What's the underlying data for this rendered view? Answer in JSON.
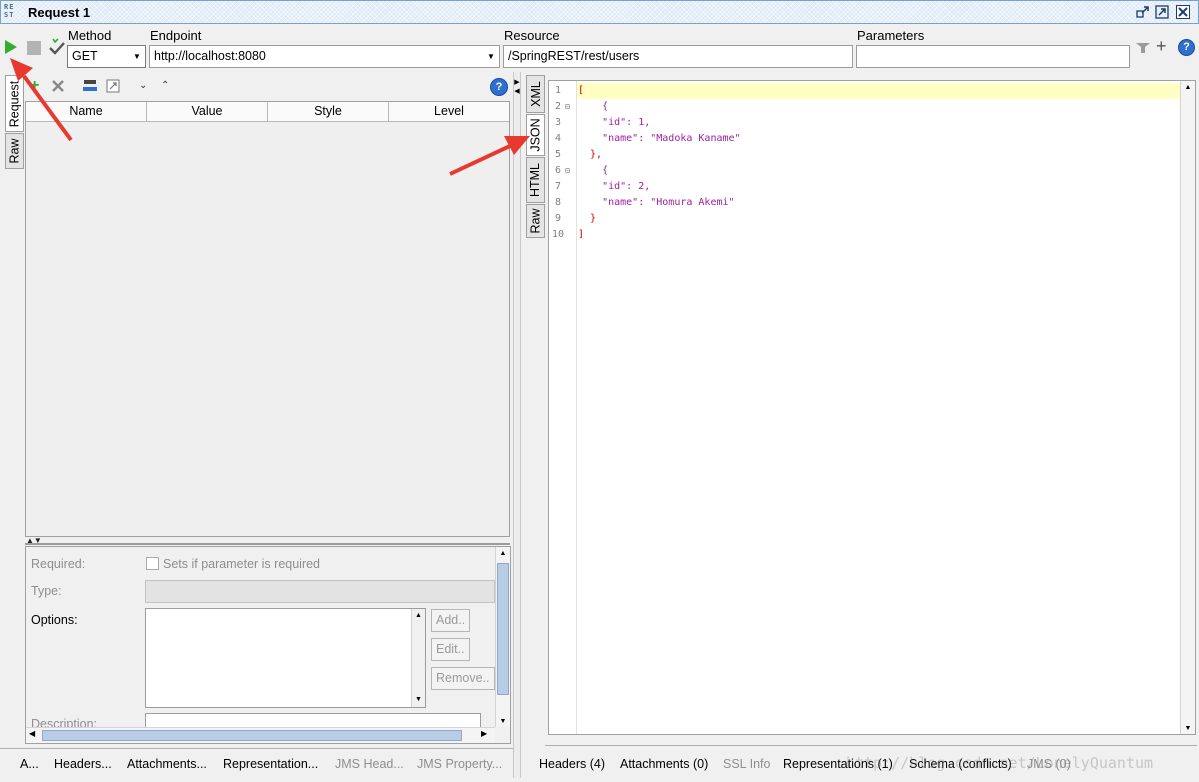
{
  "window": {
    "logo": "RE ST",
    "title": "Request 1"
  },
  "toolbar": {
    "method_label": "Method",
    "method_value": "GET",
    "endpoint_label": "Endpoint",
    "endpoint_value": "http://localhost:8080",
    "resource_label": "Resource",
    "resource_value": "/SpringREST/rest/users",
    "parameters_label": "Parameters",
    "parameters_value": ""
  },
  "request_tabs": [
    "Request",
    "Raw"
  ],
  "params_table": {
    "columns": [
      "Name",
      "Value",
      "Style",
      "Level"
    ]
  },
  "param_details": {
    "required_label": "Required:",
    "required_checkbox_label": "Sets if parameter is required",
    "type_label": "Type:",
    "options_label": "Options:",
    "description_label": "Description:",
    "buttons": [
      "Add..",
      "Edit..",
      "Remove.."
    ]
  },
  "response_tabs": [
    "XML",
    "JSON",
    "HTML",
    "Raw"
  ],
  "json_lines": [
    {
      "n": "1",
      "text": "["
    },
    {
      "n": "2",
      "text": "    {"
    },
    {
      "n": "3",
      "text": "    \"id\": 1,"
    },
    {
      "n": "4",
      "text": "    \"name\": \"Madoka Kaname\""
    },
    {
      "n": "5",
      "text": "  },"
    },
    {
      "n": "6",
      "text": "    {"
    },
    {
      "n": "7",
      "text": "    \"id\": 2,"
    },
    {
      "n": "8",
      "text": "    \"name\": \"Homura Akemi\""
    },
    {
      "n": "9",
      "text": "  }"
    },
    {
      "n": "10",
      "text": "]"
    }
  ],
  "bottom_left_tabs": [
    "A...",
    "Headers...",
    "Attachments...",
    "Representation...",
    "JMS Head...",
    "JMS Property..."
  ],
  "bottom_right_tabs": [
    "Headers (4)",
    "Attachments (0)",
    "SSL Info",
    "Representations (1)",
    "Schema (conflicts)",
    "JMS (0)"
  ],
  "watermark": "http://blog.csdn.net/LonelyQuantum",
  "colors": {
    "json_key": "#a020a0",
    "json_bracket": "#d00000",
    "json_number": "#0000c0",
    "highlight_line": "#ffffc4",
    "annotation_arrow": "#e8392f",
    "run_icon": "#2fae2f"
  }
}
